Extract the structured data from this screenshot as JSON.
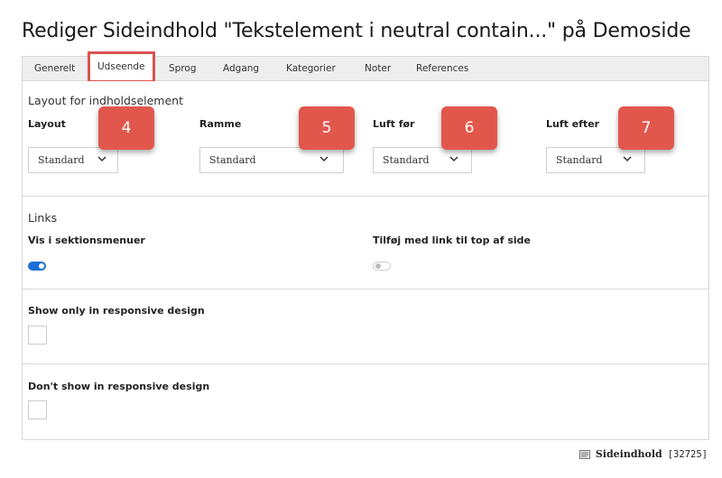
{
  "page": {
    "title": "Rediger Sideindhold \"Tekstelement i neutral contain...\" på Demoside"
  },
  "tabs": [
    {
      "label": "Generelt",
      "active": false
    },
    {
      "label": "Udseende",
      "active": true
    },
    {
      "label": "Sprog",
      "active": false
    },
    {
      "label": "Adgang",
      "active": false
    },
    {
      "label": "Kategorier",
      "active": false
    },
    {
      "label": "Noter",
      "active": false
    },
    {
      "label": "References",
      "active": false
    }
  ],
  "layout_section": {
    "heading": "Layout for indholdselement",
    "fields": [
      {
        "label": "Layout",
        "value": "Standard",
        "badge": "4"
      },
      {
        "label": "Ramme",
        "value": "Standard",
        "badge": "5"
      },
      {
        "label": "Luft før",
        "value": "Standard",
        "badge": "6"
      },
      {
        "label": "Luft efter",
        "value": "Standard",
        "badge": "7"
      }
    ]
  },
  "links_section": {
    "heading": "Links",
    "show_in_section_menus": {
      "label": "Vis i sektionsmenuer",
      "checked": true
    },
    "add_top_link": {
      "label": "Tilføj med link til top af side",
      "checked": false
    }
  },
  "responsive_only": {
    "label": "Show only in responsive design",
    "checked": false
  },
  "responsive_hide": {
    "label": "Don't show in responsive design",
    "checked": false
  },
  "footer": {
    "icon": "document-icon",
    "type_name": "Sideindhold",
    "record_id": "[32725]"
  },
  "colors": {
    "badge": "#e2574c",
    "tab_highlight": "#d9534f",
    "toggle_on": "#1d6fd6"
  }
}
